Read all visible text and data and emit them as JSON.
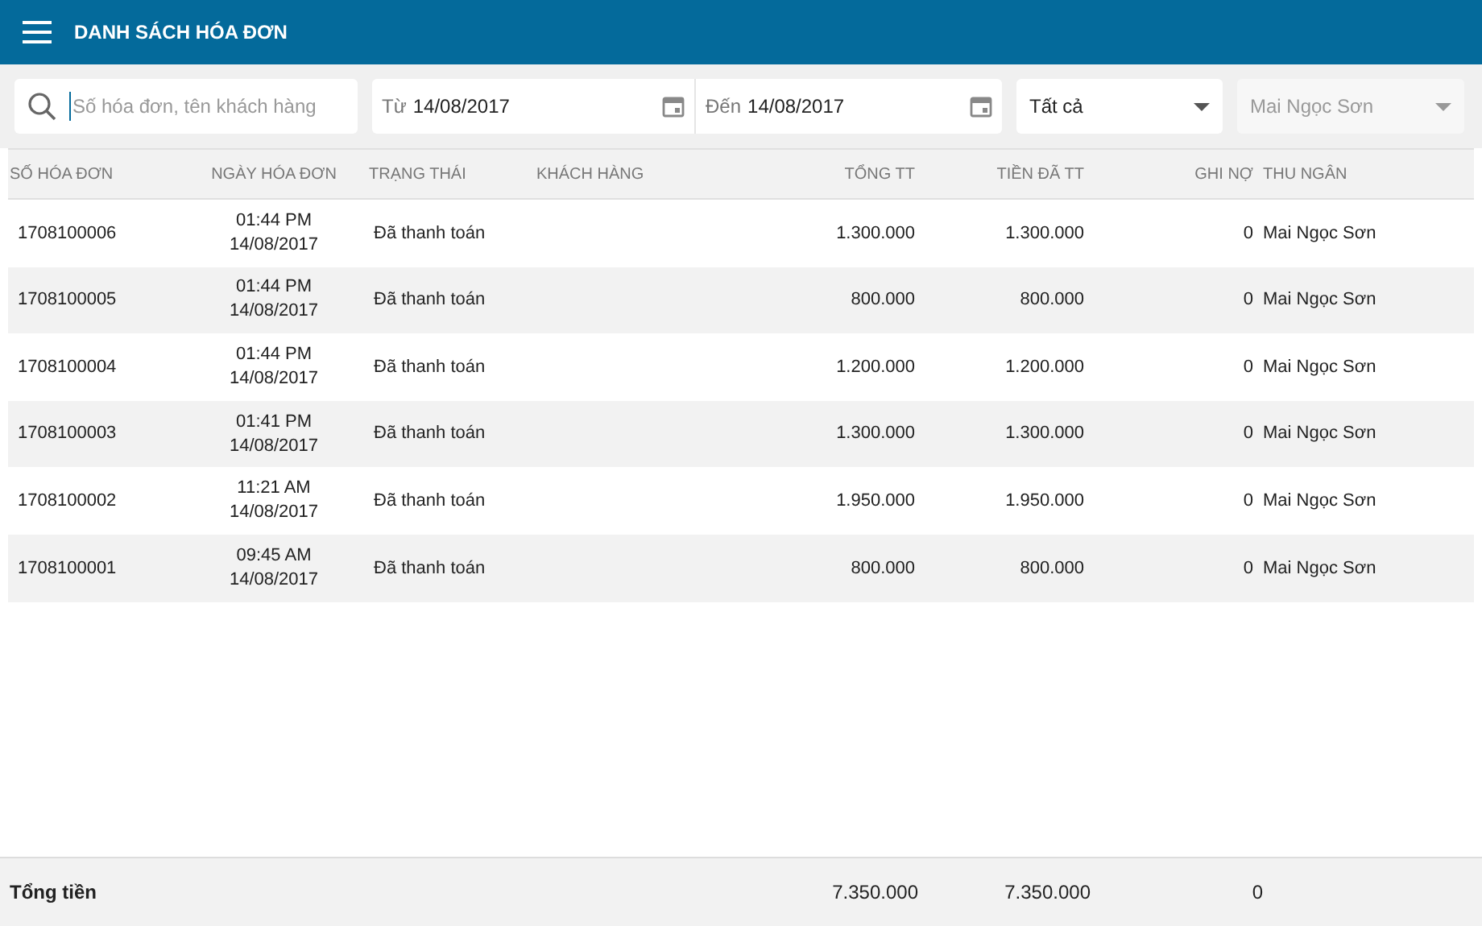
{
  "app_bar": {
    "title": "DANH SÁCH HÓA ĐƠN"
  },
  "filters": {
    "search": {
      "placeholder": "Số hóa đơn, tên khách hàng"
    },
    "from": {
      "label": "Từ",
      "value": "14/08/2017"
    },
    "to": {
      "label": "Đến",
      "value": "14/08/2017"
    },
    "status": {
      "value": "Tất cả",
      "disabled": false
    },
    "cashier": {
      "value": "Mai Ngọc Sơn",
      "disabled": true
    }
  },
  "table": {
    "columns": [
      "SỐ HÓA ĐƠN",
      "NGÀY HÓA ĐƠN",
      "TRẠNG THÁI",
      "KHÁCH HÀNG",
      "TỔNG TT",
      "TIỀN ĐÃ TT",
      "GHI NỢ",
      "THU NGÂN"
    ],
    "rows": [
      {
        "number": "1708100006",
        "time": "01:44 PM",
        "date": "14/08/2017",
        "status": "Đã thanh toán",
        "total": "1.300.000",
        "paid": "1.300.000",
        "debt": "0",
        "cashier": "Mai Ngọc Sơn"
      },
      {
        "number": "1708100005",
        "time": "01:44 PM",
        "date": "14/08/2017",
        "status": "Đã thanh toán",
        "total": "800.000",
        "paid": "800.000",
        "debt": "0",
        "cashier": "Mai Ngọc Sơn"
      },
      {
        "number": "1708100004",
        "time": "01:44 PM",
        "date": "14/08/2017",
        "status": "Đã thanh toán",
        "total": "1.200.000",
        "paid": "1.200.000",
        "debt": "0",
        "cashier": "Mai Ngọc Sơn"
      },
      {
        "number": "1708100003",
        "time": "01:41 PM",
        "date": "14/08/2017",
        "status": "Đã thanh toán",
        "total": "1.300.000",
        "paid": "1.300.000",
        "debt": "0",
        "cashier": "Mai Ngọc Sơn"
      },
      {
        "number": "1708100002",
        "time": "11:21 AM",
        "date": "14/08/2017",
        "status": "Đã thanh toán",
        "total": "1.950.000",
        "paid": "1.950.000",
        "debt": "0",
        "cashier": "Mai Ngọc Sơn"
      },
      {
        "number": "1708100001",
        "time": "09:45 AM",
        "date": "14/08/2017",
        "status": "Đã thanh toán",
        "total": "800.000",
        "paid": "800.000",
        "debt": "0",
        "cashier": "Mai Ngọc Sơn"
      }
    ]
  },
  "footer": {
    "label": "Tổng tiền",
    "total": "7.350.000",
    "paid": "7.350.000",
    "debt": "0"
  }
}
